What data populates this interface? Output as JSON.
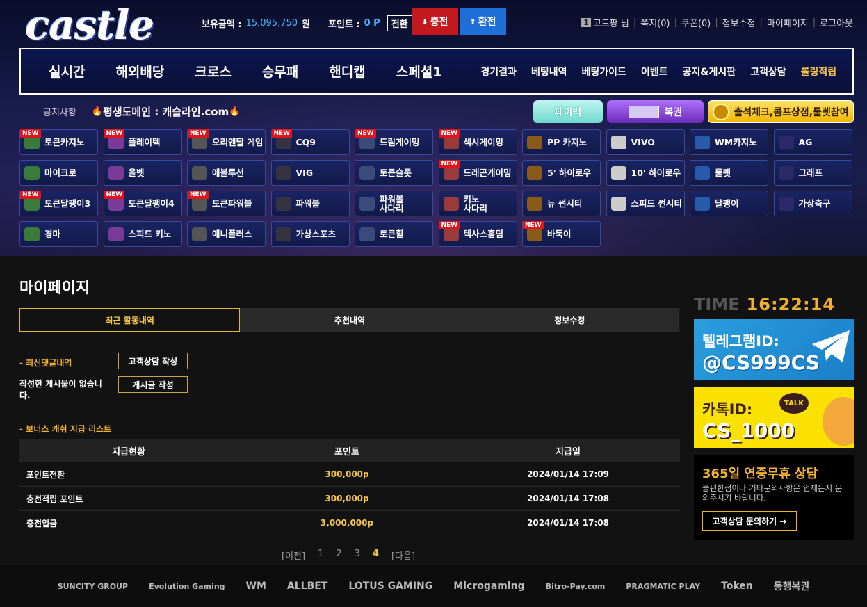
{
  "header": {
    "logo": "castle",
    "balance_label": "보유금액 :",
    "balance_value": "15,095,750",
    "balance_unit": "원",
    "point_label": "포인트 :",
    "point_value": "0 P",
    "convert_label": "전환",
    "charge_label": "충전",
    "exchange_label": "환전",
    "user_level": "1",
    "user_name": "고드팡 님",
    "links": [
      "쪽지(0)",
      "쿠폰(0)",
      "정보수정",
      "마이페이지",
      "로그아웃"
    ]
  },
  "nav": {
    "main": [
      "실시간",
      "해외배당",
      "크로스",
      "승무패",
      "핸디캡",
      "스페셜1"
    ],
    "sub": [
      "경기결과",
      "베팅내역",
      "베팅가이드",
      "이벤트",
      "공지&게시판",
      "고객상담"
    ],
    "sub_highlight": "롤링적립"
  },
  "notice": {
    "label": "공지사항",
    "message": "평생도메인 : 캐슬라인.com"
  },
  "promos": {
    "payback": "페이백",
    "lottery": "복권",
    "attendance": "출석체크,콤프상점,룰렛참여"
  },
  "games": [
    {
      "label": "토큰카지노",
      "new": true
    },
    {
      "label": "플레이텍",
      "new": true
    },
    {
      "label": "오리엔탈 게임",
      "new": true
    },
    {
      "label": "CQ9",
      "new": true
    },
    {
      "label": "드림게이밍",
      "new": true
    },
    {
      "label": "섹시게이밍",
      "new": true
    },
    {
      "label": "PP 카지노",
      "new": false
    },
    {
      "label": "VIVO",
      "new": false
    },
    {
      "label": "WM카지노",
      "new": false
    },
    {
      "label": "AG",
      "new": false
    },
    {
      "label": "마이크로",
      "new": false
    },
    {
      "label": "올벳",
      "new": false
    },
    {
      "label": "에볼루션",
      "new": false
    },
    {
      "label": "VIG",
      "new": false
    },
    {
      "label": "토큰슬롯",
      "new": false
    },
    {
      "label": "드래곤게이밍",
      "new": true
    },
    {
      "label": "5' 하이로우",
      "new": false
    },
    {
      "label": "10' 하이로우",
      "new": false
    },
    {
      "label": "룰렛",
      "new": false
    },
    {
      "label": "그래프",
      "new": false
    },
    {
      "label": "토큰달팽이3",
      "new": true
    },
    {
      "label": "토큰달팽이4",
      "new": true
    },
    {
      "label": "토큰파워볼",
      "new": true
    },
    {
      "label": "파워볼",
      "new": false
    },
    {
      "label": "파워볼\n사다리",
      "new": false
    },
    {
      "label": "키노\n사다리",
      "new": false
    },
    {
      "label": "뉴 썬시티",
      "new": false
    },
    {
      "label": "스피드 썬시티",
      "new": false
    },
    {
      "label": "달팽이",
      "new": false
    },
    {
      "label": "가상축구",
      "new": false
    },
    {
      "label": "경마",
      "new": false
    },
    {
      "label": "스피드 키노",
      "new": false
    },
    {
      "label": "애니플러스",
      "new": false
    },
    {
      "label": "가상스포츠",
      "new": false
    },
    {
      "label": "토큰휠",
      "new": false
    },
    {
      "label": "텍사스홀덤",
      "new": true
    },
    {
      "label": "바둑이",
      "new": true
    }
  ],
  "page": {
    "title": "마이페이지",
    "tabs": [
      "최근 활동내역",
      "추천내역",
      "정보수정"
    ],
    "latest_comments_label": "- 최신댓글내역",
    "support_write_button": "고객상담 작성",
    "no_posts_text": "작성한 게시물이 없습니다.",
    "post_write_button": "게시글 작성",
    "bonus_list_label": "- 보너스 캐쉬 지급 리스트",
    "table": {
      "headers": [
        "지급현황",
        "포인트",
        "지급일"
      ],
      "rows": [
        [
          "포인트전환",
          "300,000p",
          "2024/01/14 17:09"
        ],
        [
          "충전적립 포인트",
          "300,000p",
          "2024/01/14 17:08"
        ],
        [
          "충전입금",
          "3,000,000p",
          "2024/01/14 17:08"
        ]
      ]
    },
    "pager": {
      "prev": "[이전]",
      "pages": [
        "1",
        "2",
        "3",
        "4"
      ],
      "current": "4",
      "next": "[다음]"
    }
  },
  "sidebar": {
    "time_label": "TIME",
    "time_value": "16:22:14",
    "telegram_title": "텔레그램ID:",
    "telegram_id": "@CS999CS",
    "kakao_title": "카톡ID:",
    "kakao_talk": "TALK",
    "kakao_id": "CS_1000",
    "support_title": "365일 연중무휴 상담",
    "support_desc": "불편한점이나 기타문의사항은 언제든지 문의주시기 바랍니다.",
    "support_button": "고객상담 문의하기 →"
  },
  "partners": [
    "SUNCITY GROUP",
    "Evolution Gaming",
    "WM",
    "ALLBET",
    "LOTUS GAMING",
    "Microgaming",
    "Bitro-Pay.com",
    "PRAGMATIC PLAY",
    "Token",
    "동행복권"
  ],
  "colors": {
    "accent_gold": "#f5c44a",
    "charge_red": "#c4181f",
    "exchange_blue": "#1f6fd8",
    "new_badge": "#e0151b"
  }
}
